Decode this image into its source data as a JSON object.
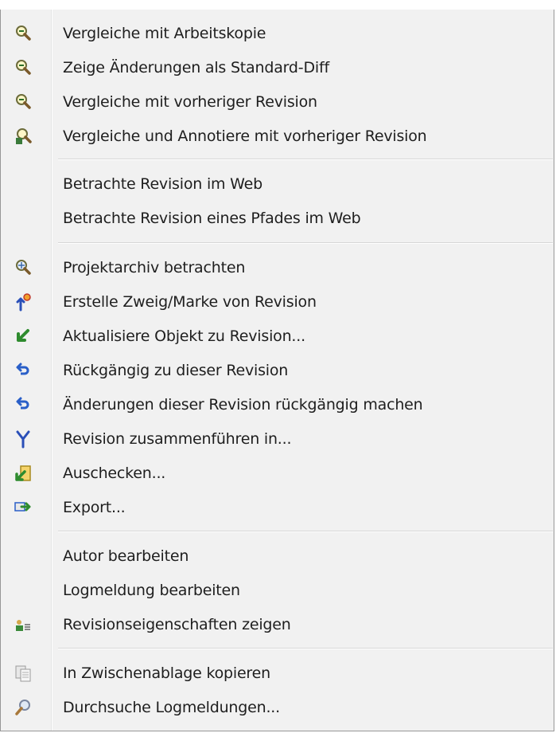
{
  "menu": {
    "items": [
      {
        "label": "Vergleiche mit Arbeitskopie",
        "icon": "magnifier-diff-icon"
      },
      {
        "label": "Zeige Änderungen als Standard-Diff",
        "icon": "magnifier-diff-icon"
      },
      {
        "label": "Vergleiche mit vorheriger Revision",
        "icon": "magnifier-diff-icon"
      },
      {
        "label": "Vergleiche und Annotiere mit vorheriger Revision",
        "icon": "magnifier-annotate-icon"
      },
      {
        "label": "Betrachte Revision im Web",
        "icon": ""
      },
      {
        "label": "Betrachte Revision eines Pfades im Web",
        "icon": ""
      },
      {
        "label": "Projektarchiv betrachten",
        "icon": "repo-browser-icon"
      },
      {
        "label": "Erstelle Zweig/Marke von Revision",
        "icon": "branch-tag-icon"
      },
      {
        "label": "Aktualisiere Objekt zu Revision...",
        "icon": "update-arrow-icon"
      },
      {
        "label": "Rückgängig zu dieser Revision",
        "icon": "revert-icon"
      },
      {
        "label": "Änderungen dieser Revision rückgängig machen",
        "icon": "revert-icon"
      },
      {
        "label": "Revision zusammenführen in...",
        "icon": "merge-icon"
      },
      {
        "label": "Auschecken...",
        "icon": "checkout-icon"
      },
      {
        "label": "Export...",
        "icon": "export-icon"
      },
      {
        "label": "Autor bearbeiten",
        "icon": ""
      },
      {
        "label": "Logmeldung bearbeiten",
        "icon": ""
      },
      {
        "label": "Revisionseigenschaften zeigen",
        "icon": "properties-icon"
      },
      {
        "label": "In Zwischenablage kopieren",
        "icon": "clipboard-icon"
      },
      {
        "label": "Durchsuche Logmeldungen...",
        "icon": "search-icon"
      }
    ]
  }
}
